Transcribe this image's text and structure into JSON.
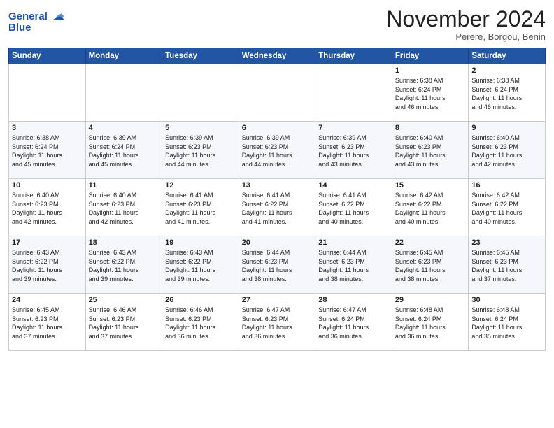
{
  "header": {
    "logo_line1": "General",
    "logo_line2": "Blue",
    "month": "November 2024",
    "location": "Perere, Borgou, Benin"
  },
  "days_of_week": [
    "Sunday",
    "Monday",
    "Tuesday",
    "Wednesday",
    "Thursday",
    "Friday",
    "Saturday"
  ],
  "weeks": [
    [
      {
        "day": "",
        "info": ""
      },
      {
        "day": "",
        "info": ""
      },
      {
        "day": "",
        "info": ""
      },
      {
        "day": "",
        "info": ""
      },
      {
        "day": "",
        "info": ""
      },
      {
        "day": "1",
        "info": "Sunrise: 6:38 AM\nSunset: 6:24 PM\nDaylight: 11 hours\nand 46 minutes."
      },
      {
        "day": "2",
        "info": "Sunrise: 6:38 AM\nSunset: 6:24 PM\nDaylight: 11 hours\nand 46 minutes."
      }
    ],
    [
      {
        "day": "3",
        "info": "Sunrise: 6:38 AM\nSunset: 6:24 PM\nDaylight: 11 hours\nand 45 minutes."
      },
      {
        "day": "4",
        "info": "Sunrise: 6:39 AM\nSunset: 6:24 PM\nDaylight: 11 hours\nand 45 minutes."
      },
      {
        "day": "5",
        "info": "Sunrise: 6:39 AM\nSunset: 6:23 PM\nDaylight: 11 hours\nand 44 minutes."
      },
      {
        "day": "6",
        "info": "Sunrise: 6:39 AM\nSunset: 6:23 PM\nDaylight: 11 hours\nand 44 minutes."
      },
      {
        "day": "7",
        "info": "Sunrise: 6:39 AM\nSunset: 6:23 PM\nDaylight: 11 hours\nand 43 minutes."
      },
      {
        "day": "8",
        "info": "Sunrise: 6:40 AM\nSunset: 6:23 PM\nDaylight: 11 hours\nand 43 minutes."
      },
      {
        "day": "9",
        "info": "Sunrise: 6:40 AM\nSunset: 6:23 PM\nDaylight: 11 hours\nand 42 minutes."
      }
    ],
    [
      {
        "day": "10",
        "info": "Sunrise: 6:40 AM\nSunset: 6:23 PM\nDaylight: 11 hours\nand 42 minutes."
      },
      {
        "day": "11",
        "info": "Sunrise: 6:40 AM\nSunset: 6:23 PM\nDaylight: 11 hours\nand 42 minutes."
      },
      {
        "day": "12",
        "info": "Sunrise: 6:41 AM\nSunset: 6:23 PM\nDaylight: 11 hours\nand 41 minutes."
      },
      {
        "day": "13",
        "info": "Sunrise: 6:41 AM\nSunset: 6:22 PM\nDaylight: 11 hours\nand 41 minutes."
      },
      {
        "day": "14",
        "info": "Sunrise: 6:41 AM\nSunset: 6:22 PM\nDaylight: 11 hours\nand 40 minutes."
      },
      {
        "day": "15",
        "info": "Sunrise: 6:42 AM\nSunset: 6:22 PM\nDaylight: 11 hours\nand 40 minutes."
      },
      {
        "day": "16",
        "info": "Sunrise: 6:42 AM\nSunset: 6:22 PM\nDaylight: 11 hours\nand 40 minutes."
      }
    ],
    [
      {
        "day": "17",
        "info": "Sunrise: 6:43 AM\nSunset: 6:22 PM\nDaylight: 11 hours\nand 39 minutes."
      },
      {
        "day": "18",
        "info": "Sunrise: 6:43 AM\nSunset: 6:22 PM\nDaylight: 11 hours\nand 39 minutes."
      },
      {
        "day": "19",
        "info": "Sunrise: 6:43 AM\nSunset: 6:22 PM\nDaylight: 11 hours\nand 39 minutes."
      },
      {
        "day": "20",
        "info": "Sunrise: 6:44 AM\nSunset: 6:23 PM\nDaylight: 11 hours\nand 38 minutes."
      },
      {
        "day": "21",
        "info": "Sunrise: 6:44 AM\nSunset: 6:23 PM\nDaylight: 11 hours\nand 38 minutes."
      },
      {
        "day": "22",
        "info": "Sunrise: 6:45 AM\nSunset: 6:23 PM\nDaylight: 11 hours\nand 38 minutes."
      },
      {
        "day": "23",
        "info": "Sunrise: 6:45 AM\nSunset: 6:23 PM\nDaylight: 11 hours\nand 37 minutes."
      }
    ],
    [
      {
        "day": "24",
        "info": "Sunrise: 6:45 AM\nSunset: 6:23 PM\nDaylight: 11 hours\nand 37 minutes."
      },
      {
        "day": "25",
        "info": "Sunrise: 6:46 AM\nSunset: 6:23 PM\nDaylight: 11 hours\nand 37 minutes."
      },
      {
        "day": "26",
        "info": "Sunrise: 6:46 AM\nSunset: 6:23 PM\nDaylight: 11 hours\nand 36 minutes."
      },
      {
        "day": "27",
        "info": "Sunrise: 6:47 AM\nSunset: 6:23 PM\nDaylight: 11 hours\nand 36 minutes."
      },
      {
        "day": "28",
        "info": "Sunrise: 6:47 AM\nSunset: 6:24 PM\nDaylight: 11 hours\nand 36 minutes."
      },
      {
        "day": "29",
        "info": "Sunrise: 6:48 AM\nSunset: 6:24 PM\nDaylight: 11 hours\nand 36 minutes."
      },
      {
        "day": "30",
        "info": "Sunrise: 6:48 AM\nSunset: 6:24 PM\nDaylight: 11 hours\nand 35 minutes."
      }
    ]
  ]
}
